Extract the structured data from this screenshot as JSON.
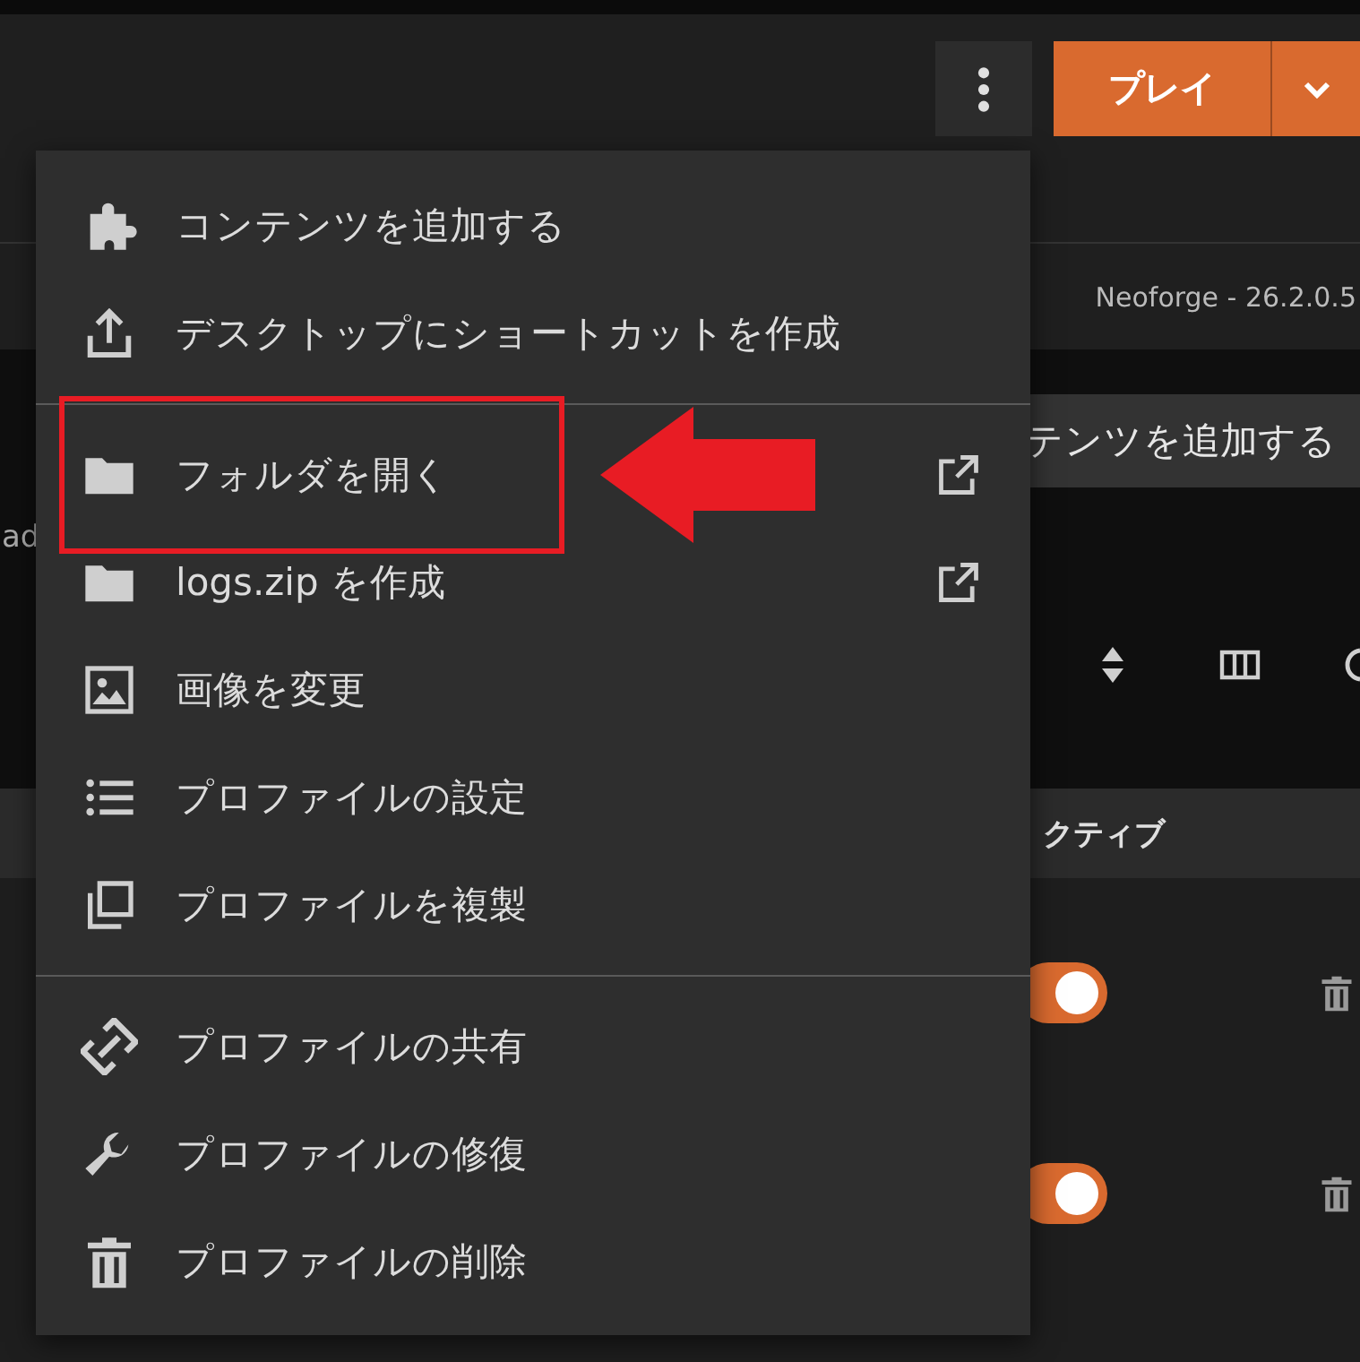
{
  "header": {
    "play_button": "プレイ"
  },
  "breadcrumb": {
    "loader": "Neoforge - 26.2.0.5"
  },
  "content": {
    "add_button": "テンツを追加する",
    "side_text": "ad"
  },
  "table": {
    "columns": [
      {
        "label": "クティブ"
      }
    ],
    "rows": [
      {
        "on": true
      },
      {
        "on": true
      }
    ]
  },
  "menu": {
    "groups": [
      [
        {
          "label": "コンテンツを追加する",
          "external": false,
          "highlighted": false
        },
        {
          "label": "デスクトップにショートカットを作成",
          "external": false,
          "highlighted": false
        }
      ],
      [
        {
          "label": "フォルダを開く",
          "external": true,
          "highlighted": true
        },
        {
          "label": "logs.zip を作成",
          "external": true,
          "highlighted": false
        },
        {
          "label": "画像を変更",
          "external": false,
          "highlighted": false
        },
        {
          "label": "プロファイルの設定",
          "external": false,
          "highlighted": false
        },
        {
          "label": "プロファイルを複製",
          "external": false,
          "highlighted": false
        }
      ],
      [
        {
          "label": "プロファイルの共有",
          "external": false,
          "highlighted": false
        },
        {
          "label": "プロファイルの修復",
          "external": false,
          "highlighted": false
        },
        {
          "label": "プロファイルの削除",
          "external": false,
          "highlighted": false
        }
      ]
    ]
  }
}
